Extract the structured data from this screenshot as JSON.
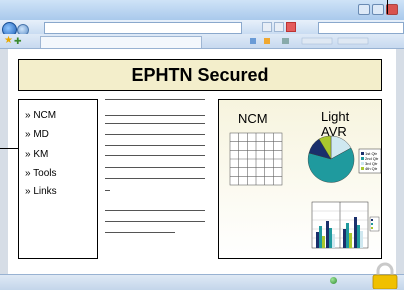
{
  "banner": {
    "title": "EPHTN Secured"
  },
  "nav": {
    "items": [
      {
        "label": "» NCM"
      },
      {
        "label": "» MD"
      },
      {
        "label": "» KM"
      },
      {
        "label": "» Tools"
      },
      {
        "label": "» Links"
      }
    ]
  },
  "right_panel": {
    "ncm_label": "NCM",
    "light_label": "Light AVR"
  },
  "pie_legend": [
    "1st Qtr",
    "2nd Qtr",
    "3rd Qtr",
    "4th Qtr"
  ],
  "colors": {
    "banner_bg": "#f3eecb",
    "pie_teal": "#1f9a9e",
    "pie_navy": "#1a2f6b",
    "pie_lime": "#a9c82e",
    "pie_light": "#cfe8f0"
  },
  "icons": [
    "back-arrow-icon",
    "forward-arrow-icon",
    "favorites-star-icon",
    "add-favorite-icon",
    "globe-icon",
    "padlock-icon"
  ]
}
